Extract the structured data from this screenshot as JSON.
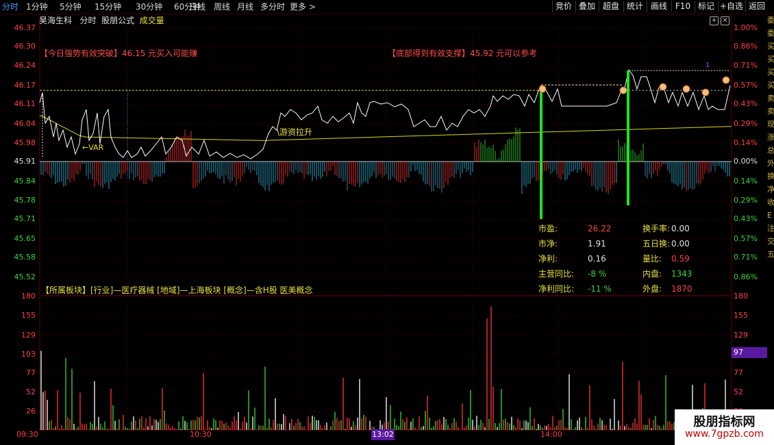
{
  "topbar": {
    "periods": [
      "分时",
      "1分钟",
      "5分钟",
      "15分钟",
      "30分钟",
      "60分钟",
      "日线",
      "周线",
      "月线",
      "多分时",
      "更多"
    ],
    "more_chevron": ">",
    "right_buttons": [
      "竞价",
      "叠加",
      "超盘",
      "统计",
      "画线",
      "F10",
      "标记",
      "+自选",
      "返回"
    ]
  },
  "header": {
    "stock_name": "昊海生科",
    "chart_type": "分时",
    "formula": "股朋公式",
    "indicator": "成交量"
  },
  "price_axis": {
    "left": [
      "46.37",
      "46.30",
      "46.24",
      "46.17",
      "46.11",
      "46.04",
      "45.98",
      "45.91",
      "45.84",
      "45.78",
      "45.71",
      "45.65",
      "45.58",
      "45.52"
    ],
    "right": [
      "1.00%",
      "0.86%",
      "0.71%",
      "0.57%",
      "0.43%",
      "0.29%",
      "0.14%",
      "0.00%",
      "0.14%",
      "0.29%",
      "0.43%",
      "0.57%",
      "0.71%",
      "0.86%"
    ]
  },
  "signals": {
    "left": "【今日强势有效突破】46.15 元买入可能赚",
    "right": "【底部得到有效支撑】45.92 元可以参考",
    "var_label": "←VAR",
    "youzi_label": "\\游资拉升",
    "marker_1": "1"
  },
  "sector": {
    "text": "【所属板块】[行业]—医疗器械 [地域]—上海板块 [概念]—含H股 医美概念"
  },
  "stats": {
    "rows": [
      {
        "k1": "市盈:",
        "v1": "26.22",
        "c1": "#ff4040",
        "k2": "换手率:",
        "v2": "0.00",
        "c2": "#e0e0e0"
      },
      {
        "k1": "市净:",
        "v1": "1.91",
        "c1": "#e0e0e0",
        "k2": "五日换:",
        "v2": "0.00",
        "c2": "#e0e0e0"
      },
      {
        "k1": "净利:",
        "v1": "0.16",
        "c1": "#e0e0e0",
        "k2": "量比:",
        "v2": "0.59",
        "c2": "#ff4040"
      },
      {
        "k1": "主营同比:",
        "v1": "-8 %",
        "c1": "#3cd23c",
        "k2": "内盘:",
        "v2": "1343",
        "c2": "#3cd23c"
      },
      {
        "k1": "净利同比:",
        "v1": "-11 %",
        "c1": "#3cd23c",
        "k2": "外盘:",
        "v2": "1870",
        "c2": "#ff4040"
      }
    ]
  },
  "volume_axis": {
    "labels": [
      "180",
      "155",
      "129",
      "103",
      "77",
      "52",
      "26"
    ],
    "highlight": "97"
  },
  "time_axis": {
    "labels": [
      "09:30",
      "10:30",
      "14:00"
    ],
    "cursor": "13:02"
  },
  "watermark": {
    "title": "股朋指标网",
    "url": "www.7gpzb.com"
  },
  "right_strip": [
    "委",
    "委",
    "买",
    "买",
    "买",
    "买",
    "卖",
    "卖",
    "现",
    "涨",
    "总",
    "外",
    "换",
    "净",
    "收",
    "E",
    "注",
    "交",
    "五"
  ],
  "colors": {
    "price_line": "#ffffff",
    "avg_line": "#d8d820",
    "up": "#e03030",
    "down": "#30c030",
    "accent": "#3c9cff",
    "grid": "#5a0000"
  }
}
